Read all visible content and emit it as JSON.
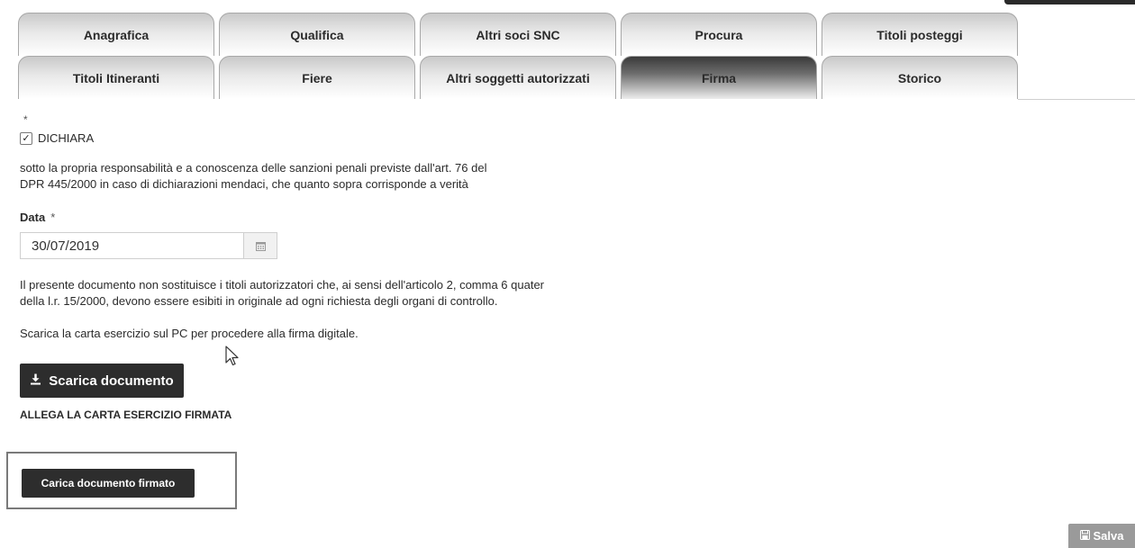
{
  "tabs_row1": [
    {
      "label": "Anagrafica"
    },
    {
      "label": "Qualifica"
    },
    {
      "label": "Altri soci SNC"
    },
    {
      "label": "Procura"
    },
    {
      "label": "Titoli posteggi"
    }
  ],
  "tabs_row2": [
    {
      "label": "Titoli Itineranti"
    },
    {
      "label": "Fiere"
    },
    {
      "label": "Altri soggetti autorizzati"
    },
    {
      "label": "Firma",
      "active": true
    },
    {
      "label": "Storico"
    }
  ],
  "form": {
    "required_mark": "*",
    "dichiara": {
      "label": "DICHIARA",
      "checked": true
    },
    "declaration_line1": "sotto la propria responsabilità e a conoscenza delle sanzioni penali previste dall'art. 76 del",
    "declaration_line2": "DPR 445/2000 in caso di dichiarazioni mendaci, che quanto sopra corrisponde a verità",
    "date_label": "Data",
    "date_required": "*",
    "date_value": "30/07/2019",
    "info_line1": "Il presente documento non sostituisce i titoli autorizzatori che, ai sensi dell'articolo 2, comma 6 quater",
    "info_line2": "della l.r. 15/2000, devono essere esibiti in originale ad ogni richiesta degli organi di controllo.",
    "download_hint": "Scarica la carta esercizio sul PC per procedere alla firma digitale.",
    "download_button": "Scarica documento",
    "attach_label": "ALLEGA LA CARTA ESERCIZIO FIRMATA",
    "upload_button": "Carica documento firmato"
  },
  "footer": {
    "save_button": "Salva"
  },
  "icons": {
    "checkbox": "check-icon",
    "calendar": "calendar-icon",
    "download": "download-icon",
    "save": "floppy-disk-icon",
    "cursor": "mouse-pointer-icon"
  },
  "colors": {
    "dark_button": "#2d2d2d",
    "save_button": "#9a9a9a",
    "active_tab_top": "#3a3a3a"
  }
}
